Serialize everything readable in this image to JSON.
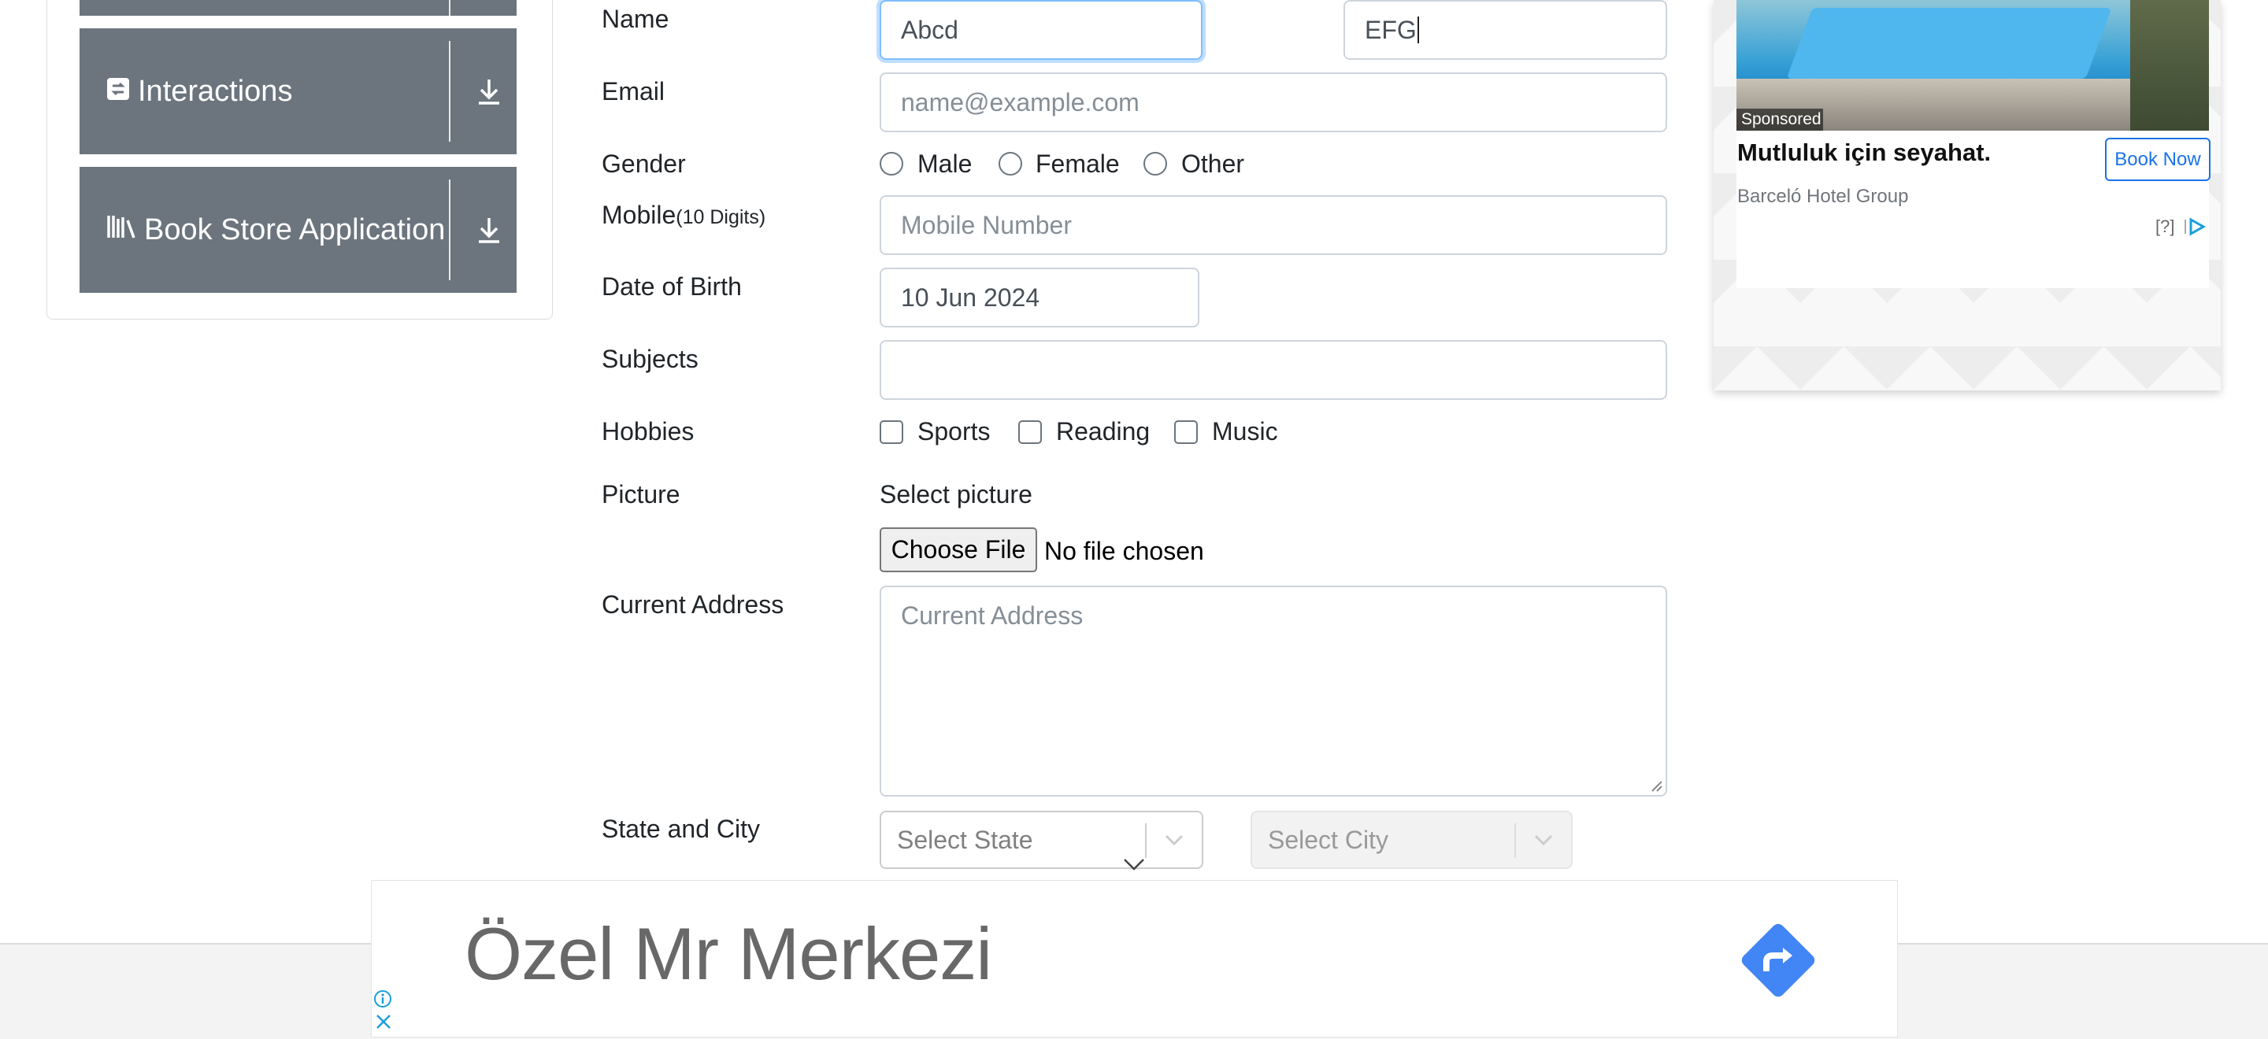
{
  "sidebar": {
    "items": [
      {
        "label": "Interactions",
        "icon": "interactions-icon"
      },
      {
        "label": "Book Store Application",
        "icon": "books-icon"
      }
    ]
  },
  "form": {
    "name_label": "Name",
    "first_name_value": "Abcd",
    "last_name_value": "EFG",
    "email_label": "Email",
    "email_placeholder": "name@example.com",
    "gender_label": "Gender",
    "gender_options": [
      "Male",
      "Female",
      "Other"
    ],
    "mobile_label": "Mobile",
    "mobile_hint": "(10 Digits)",
    "mobile_placeholder": "Mobile Number",
    "dob_label": "Date of Birth",
    "dob_value": "10 Jun 2024",
    "subjects_label": "Subjects",
    "hobbies_label": "Hobbies",
    "hobby_options": [
      "Sports",
      "Reading",
      "Music"
    ],
    "picture_label": "Picture",
    "picture_prompt": "Select picture",
    "file_button": "Choose File",
    "file_status": "No file chosen",
    "address_label": "Current Address",
    "address_placeholder": "Current Address",
    "state_city_label": "State and City",
    "state_placeholder": "Select State",
    "city_placeholder": "Select City"
  },
  "ad_right": {
    "badge": "Sponsored",
    "title": "Mutluluk için seyahat.",
    "advertiser": "Barceló Hotel Group",
    "cta": "Book Now",
    "info": "[?]"
  },
  "ad_banner": {
    "text": "Özel Mr Merkezi"
  },
  "colors": {
    "sidebar_bg": "#6c757d",
    "focus_border": "#80bdff",
    "ad_link": "#1a73e8",
    "banner_arrow": "#4285f4"
  }
}
